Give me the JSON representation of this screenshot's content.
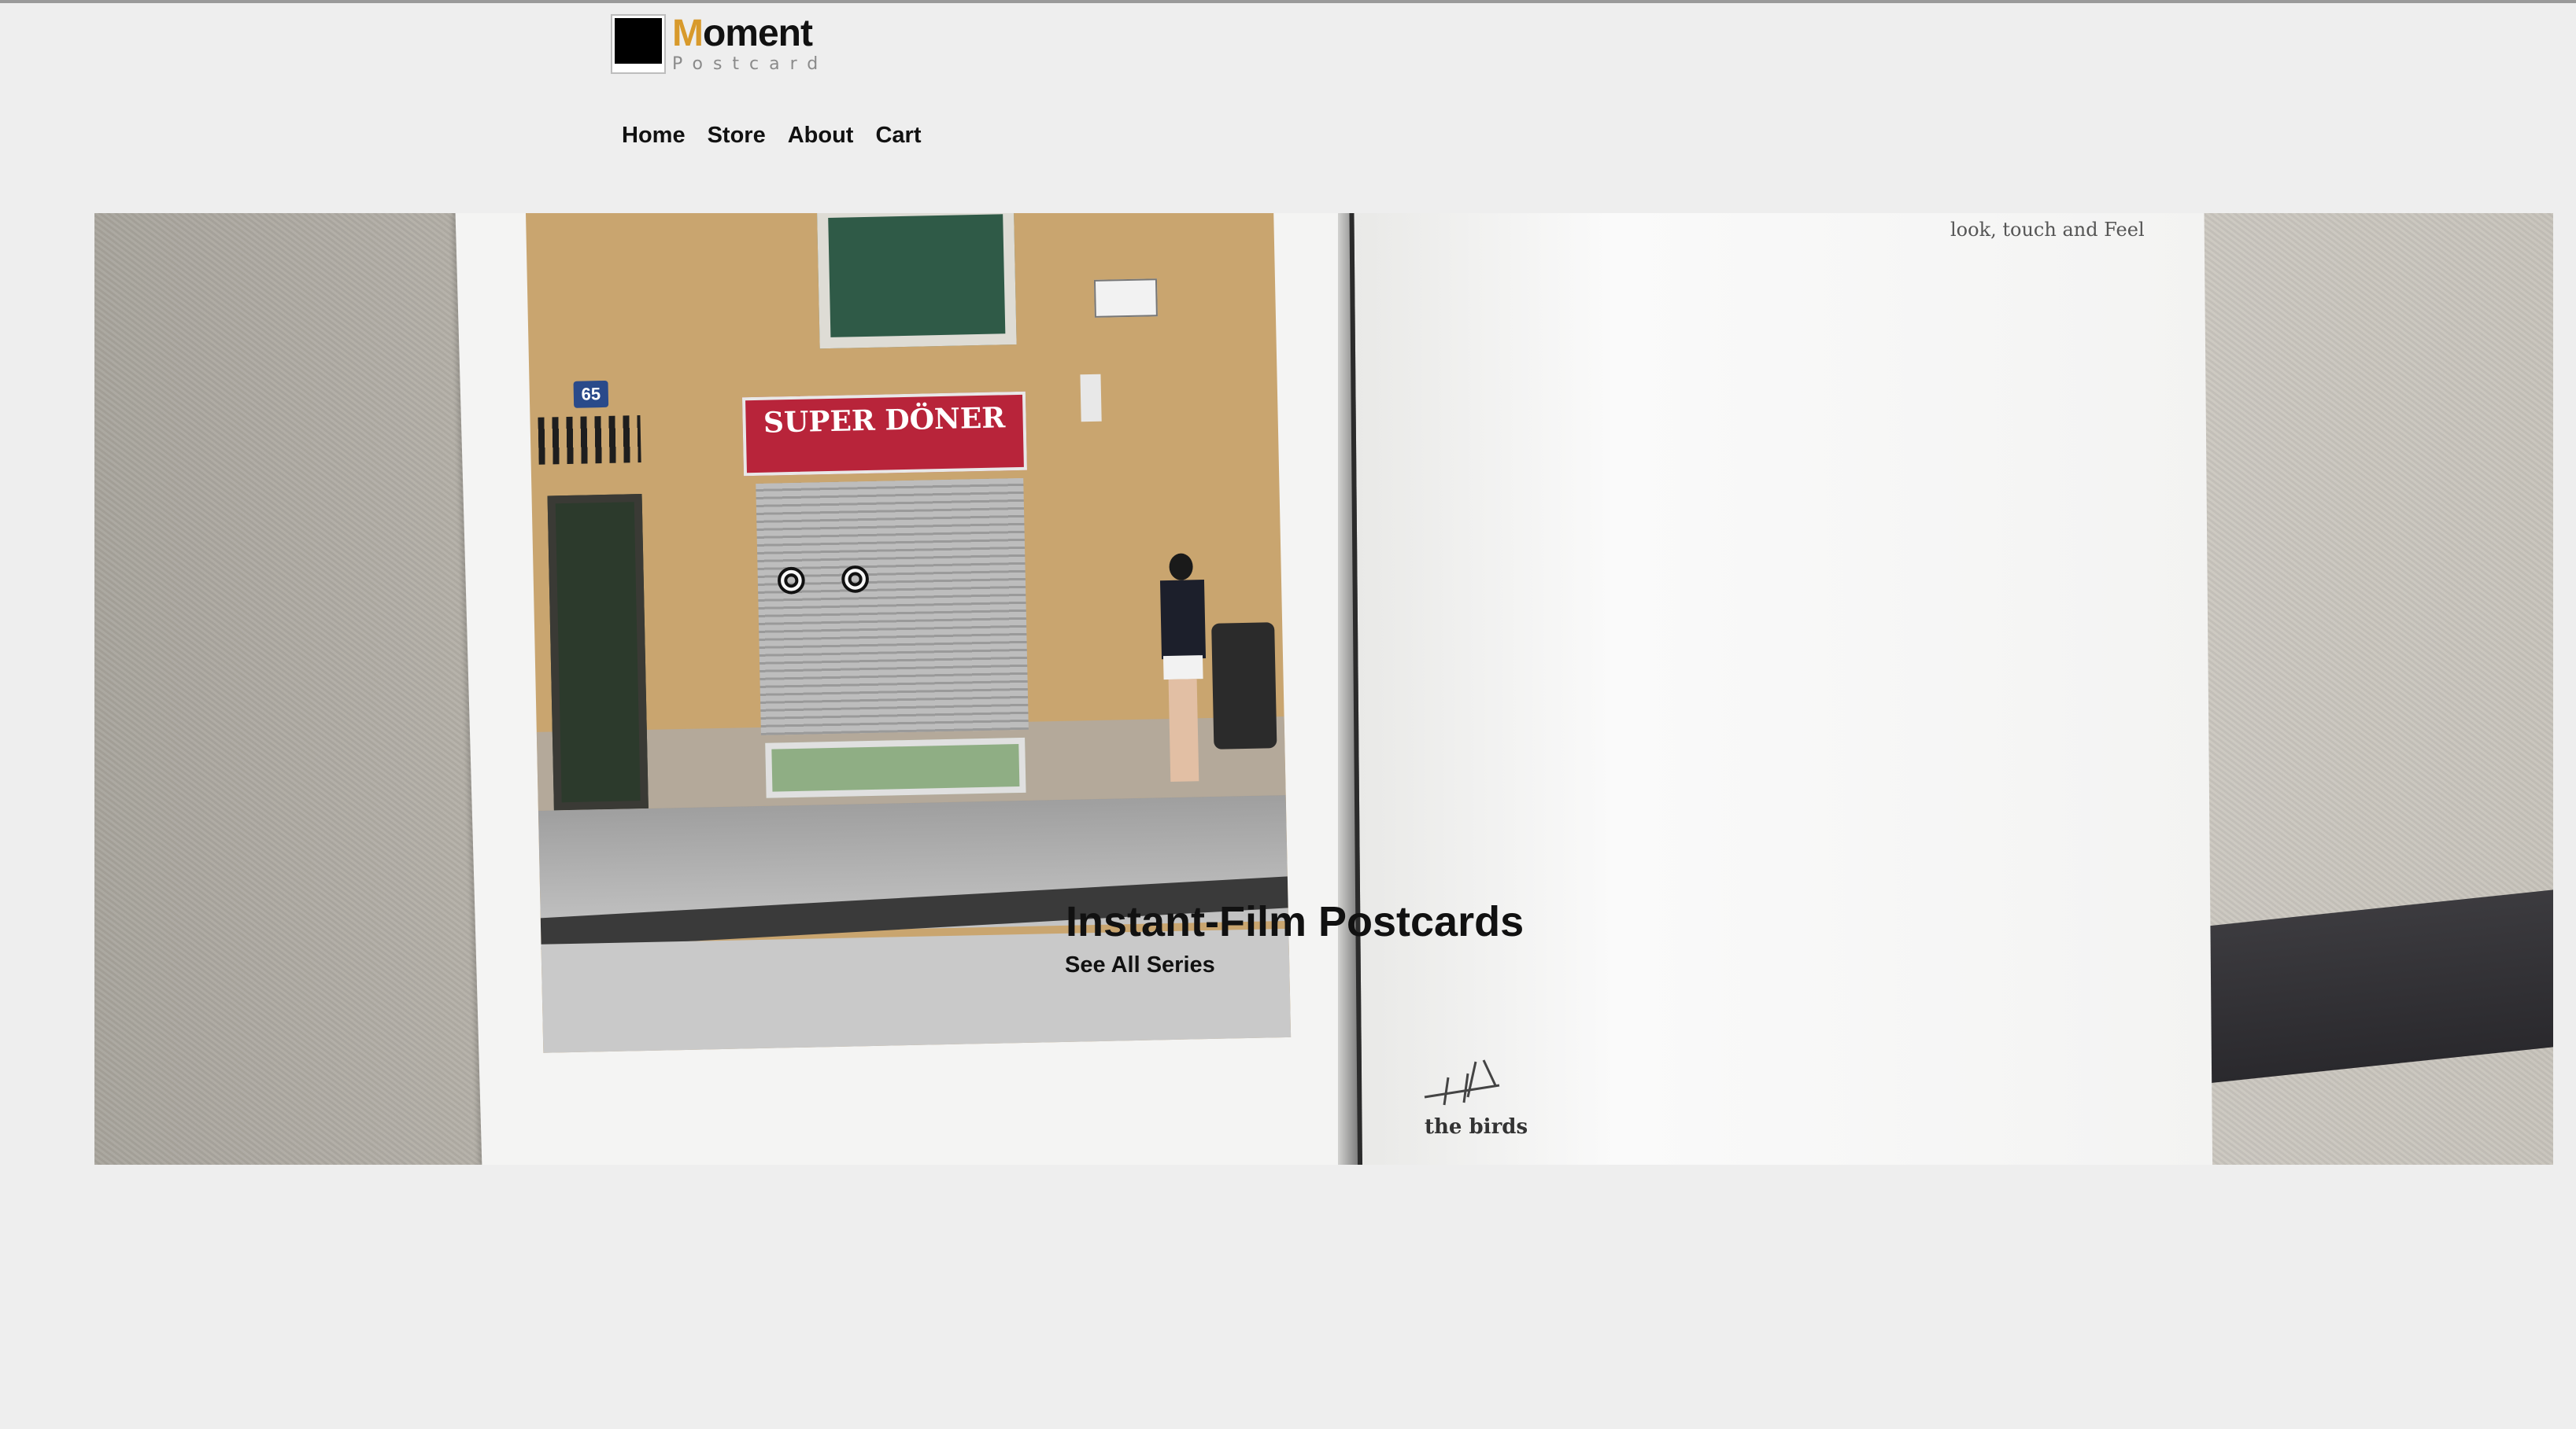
{
  "brand": {
    "name_first_letter": "M",
    "name_rest": "oment",
    "subtitle": "Postcard",
    "accent_color": "#d89a2c"
  },
  "nav": {
    "items": [
      {
        "label": "Home"
      },
      {
        "label": "Store"
      },
      {
        "label": "About"
      },
      {
        "label": "Cart"
      }
    ]
  },
  "hero": {
    "title": "Instant-Film Postcards",
    "link_label": "See All Series",
    "photo_sign_text": "SUPER DÖNER",
    "photo_plate_number": "65",
    "card_note": "look, touch and Feel",
    "signature_text": "the birds"
  }
}
